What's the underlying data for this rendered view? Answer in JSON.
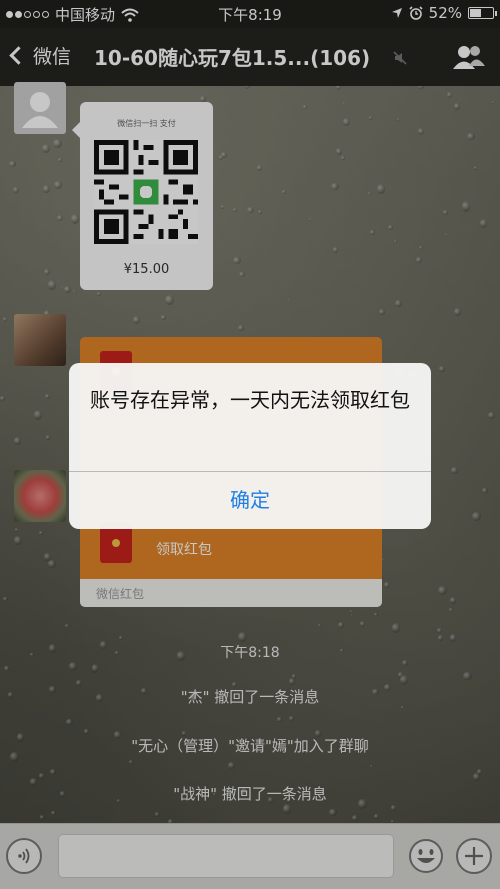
{
  "status_bar": {
    "carrier": "中国移动",
    "time": "下午8:19",
    "battery": "52%",
    "battery_level": 0.52,
    "signal_strength": 2,
    "signal_max": 5
  },
  "nav": {
    "back_label": "微信",
    "title": "10-60随心玩7包1.5...(106)"
  },
  "chat": {
    "qr_message": {
      "caption": "微信扫一扫 支付",
      "amount": "¥15.00"
    },
    "red_packet": {
      "claim_label": "领取红包",
      "footer": "微信红包"
    },
    "system_messages": {
      "time": "下午8:18",
      "recall_1": "\"杰\" 撤回了一条消息",
      "join": "\"无心（管理）\"邀请\"嫣\"加入了群聊",
      "recall_2": "\"战神\" 撤回了一条消息"
    }
  },
  "alert": {
    "message": "账号存在异常，一天内无法领取红包",
    "button_label": "确定",
    "button_color": "#1f7fe6"
  },
  "colors": {
    "red_packet": "#e0852a",
    "nav_background": "#242421"
  }
}
